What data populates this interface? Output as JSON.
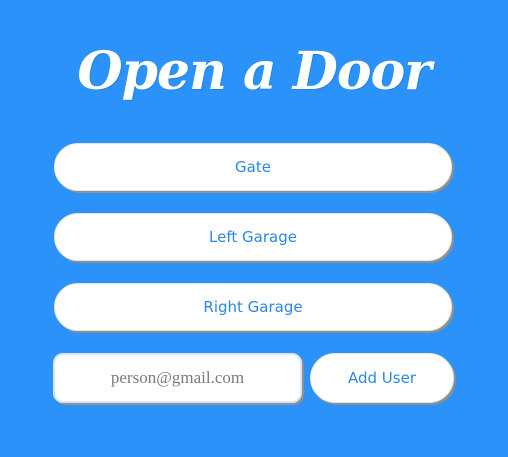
{
  "header": {
    "title": "Open a Door"
  },
  "doors": [
    {
      "label": "Gate"
    },
    {
      "label": "Left Garage"
    },
    {
      "label": "Right Garage"
    }
  ],
  "add_user": {
    "email_value": "",
    "email_placeholder": "person@gmail.com",
    "button_label": "Add User"
  },
  "colors": {
    "background": "#2b92fa",
    "button_text": "#2b87e6",
    "button_background": "#ffffff"
  }
}
